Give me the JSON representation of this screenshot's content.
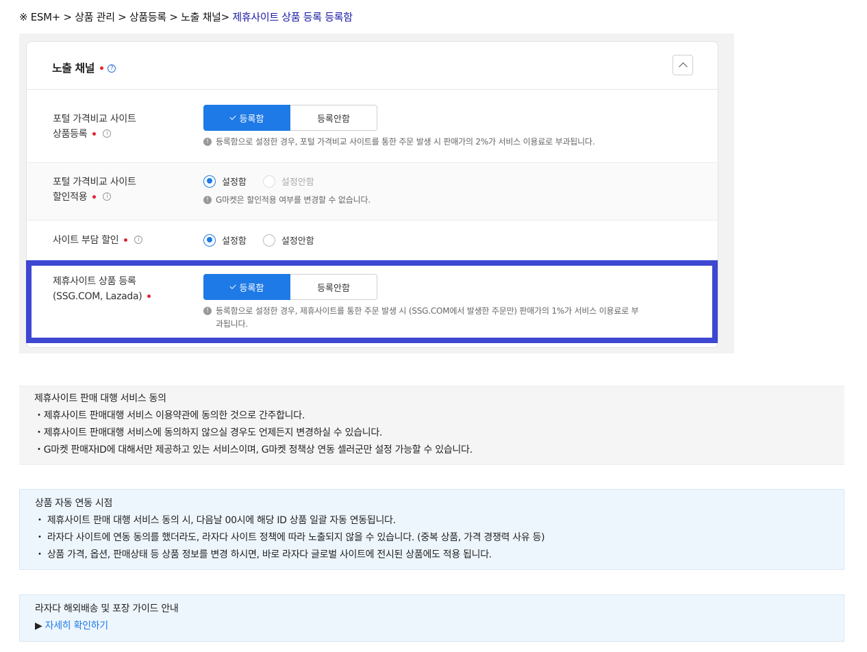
{
  "breadcrumb": {
    "prefix": "※ ESM+ > 상품 관리 > 상품등록 > 노출 채널> ",
    "current": "제휴사이트 상품 등록 등록함"
  },
  "panel": {
    "title": "노출 채널",
    "help_glyph": "?",
    "rows": [
      {
        "label_line1": "포털 가격비교 사이트",
        "label_line2": "상품등록",
        "selected": "등록함",
        "unselected": "등록안함",
        "note": "등록함으로 설정한 경우, 포털 가격비교 사이트를 통한 주문 발생 시 판매가의 2%가 서비스 이용료로 부과됩니다."
      },
      {
        "label_line1": "포털 가격비교 사이트",
        "label_line2": "할인적용",
        "option_on": "설정함",
        "option_off": "설정안함",
        "note": "G마켓은 할인적용 여부를 변경할 수 없습니다."
      },
      {
        "label": "사이트 부담 할인",
        "option_on": "설정함",
        "option_off": "설정안함"
      },
      {
        "label_line1": "제휴사이트 상품 등록",
        "label_line2": "(SSG.COM, Lazada)",
        "selected": "등록함",
        "unselected": "등록안함",
        "note_line1": "등록함으로 설정한 경우, 제휴사이트를 통한 주문 발생 시 (SSG.COM에서 발생한 주문만) 판매가의 1%가 서비스 이용료로 부",
        "note_line2": "과됩니다."
      }
    ],
    "info_glyph": "i",
    "note_glyph": "!"
  },
  "agreement": {
    "title": "제휴사이트 판매 대행 서비스 동의",
    "items": [
      "・제휴사이트 판매대행 서비스 이용약관에 동의한 것으로 간주합니다.",
      "・제휴사이트 판매대행 서비스에 동의하지 않으실 경우도 언제든지 변경하실 수 있습니다.",
      "・G마켓 판매자ID에 대해서만 제공하고 있는 서비스이며, G마켓 정책상 연동 셀러군만 설정 가능할 수 있습니다."
    ]
  },
  "sync": {
    "title": "상품 자동 연동 시점",
    "items": [
      "・ 제휴사이트 판매 대행 서비스 동의 시, 다음날 00시에 해당 ID 상품 일괄 자동 연동됩니다.",
      "・ 라자다 사이트에 연동 동의를 했더라도, 라자다 사이트 정책에 따라 노출되지 않을 수 있습니다. (중복 상품, 가격 경쟁력 사유 등)",
      "・ 상품 가격, 옵션, 판매상태 등 상품 정보를 변경 하시면, 바로 라자다 글로벌 사이트에 전시된 상품에도 적용 됩니다."
    ]
  },
  "guide": {
    "title": "라자다 해외배송 및 포장 가이드 안내",
    "arrow": "▶ ",
    "link": "자세히 확인하기"
  }
}
